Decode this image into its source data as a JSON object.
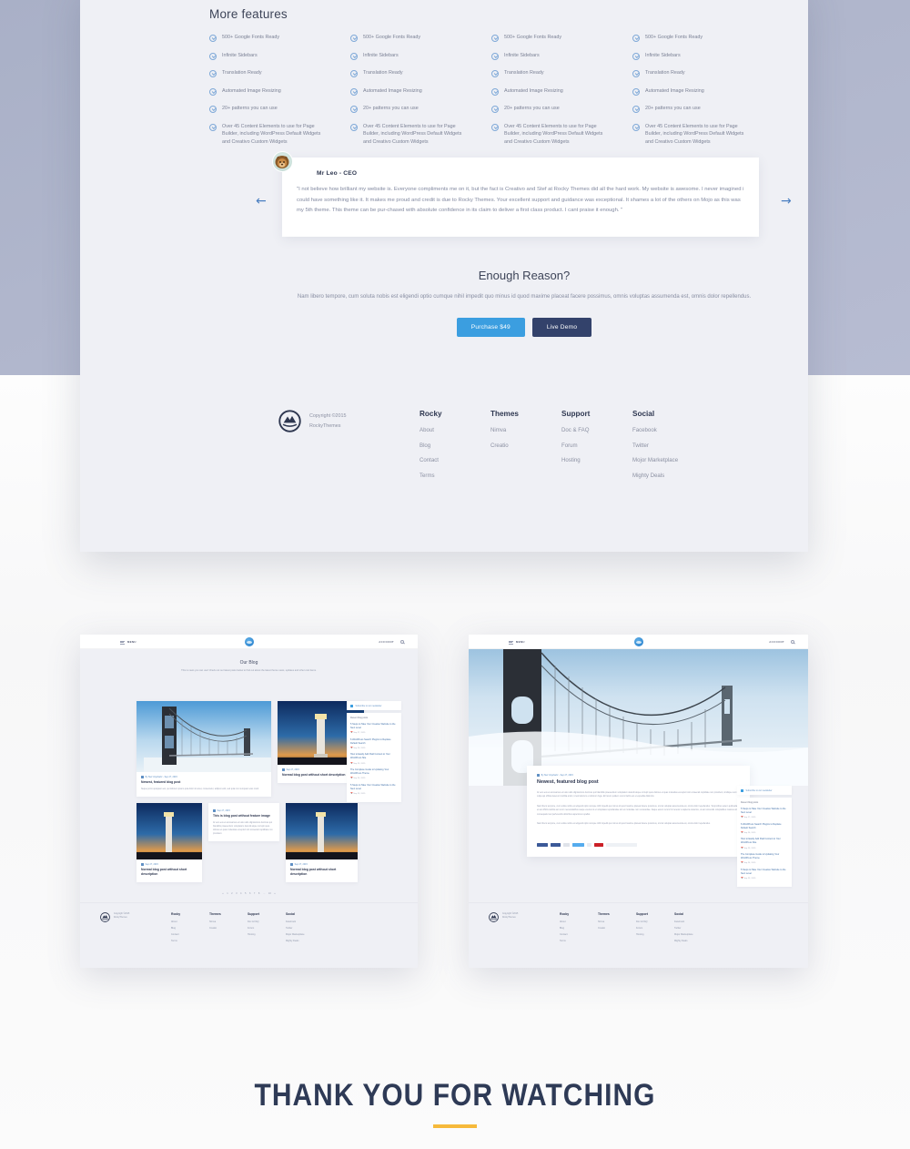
{
  "palette": {
    "page_top": "#a9b0c7",
    "panel_bg": "#eff0f5",
    "accent_blue": "#3b9ee0",
    "navy": "#33426b",
    "amber": "#f6b93b",
    "text_dark": "#2e3750",
    "text_muted": "#8b90a2"
  },
  "features": {
    "title": "More features",
    "columns": [
      [
        "500+ Google Fonts Ready",
        "Infinite Sidebars",
        "Translation Ready",
        "Automated Image Resizing",
        "20+ patterns you can use",
        "Over 45 Content Elements to use for Page Builder, including WordPress Default Widgets and Creativo Custom Widgets"
      ],
      [
        "500+ Google Fonts Ready",
        "Infinite Sidebars",
        "Translation Ready",
        "Automated Image Resizing",
        "20+ patterns you can use",
        "Over 45 Content Elements to use for Page Builder, including WordPress Default Widgets and Creativo Custom Widgets"
      ],
      [
        "500+ Google Fonts Ready",
        "Infinite Sidebars",
        "Translation Ready",
        "Automated Image Resizing",
        "20+ patterns you can use",
        "Over 45 Content Elements to use for Page Builder, including WordPress Default Widgets and Creativo Custom Widgets"
      ],
      [
        "500+ Google Fonts Ready",
        "Infinite Sidebars",
        "Translation Ready",
        "Automated Image Resizing",
        "20+ patterns you can use",
        "Over 45 Content Elements to use for Page Builder, including WordPress Default Widgets and Creativo Custom Widgets"
      ]
    ]
  },
  "testimonial": {
    "author": "Mr Leo - CEO",
    "quote": "\"I not believe how brilliant my website is. Everyone compliments me on it, but the fact is Creativo and Stef at Rocky Themes did all the hard work. My website is awesome. I never imagined i could have something like it. It makes me proud and credit is due to Rocky Themes. Your excellent support and guidance was exceptional. It shames a lot of the others on Mojo as this was my 5th theme. This theme can be pur-chased with absolute confidence in its claim to deliver a first class product. I cant praise it enough. \"",
    "prev_label": "←",
    "next_label": "→"
  },
  "cta": {
    "heading": "Enough Reason?",
    "paragraph": "Nam libero tempore, cum soluta nobis est eligendi optio cumque nihil impedit quo minus id quod maxime placeat facere possimus, omnis voluptas assumenda est, omnis dolor repellendus.",
    "purchase_label": "Purchase $49",
    "demo_label": "Live Demo"
  },
  "footer": {
    "copyright_line1": "Copyright ©2015",
    "copyright_line2": "RockyThemes",
    "columns": [
      {
        "heading": "Rocky",
        "links": [
          "About",
          "Blog",
          "Contact",
          "Terms"
        ]
      },
      {
        "heading": "Themes",
        "links": [
          "Nimva",
          "Creatio"
        ]
      },
      {
        "heading": "Support",
        "links": [
          "Doc & FAQ",
          "Forum",
          "Hosting"
        ]
      },
      {
        "heading": "Social",
        "links": [
          "Facebook",
          "Twitter",
          "Mojor Marketplace",
          "Mighty Deals"
        ]
      }
    ]
  },
  "mockup_browser": {
    "menu_label": "MENU",
    "account_label": "ACCOUNT"
  },
  "mockup_left": {
    "page_title": "Our Blog",
    "page_subtitle": "This is news you can use! Check out our latest posts below to find out about the latest theme news, updates and other cool items.",
    "cards": [
      {
        "meta": "By Stef Urquhartz - Sep 27, 2015",
        "title": "Newest, featured blog post",
        "excerpt": "Neque porro quisquam est, qui dolorem ipsum quia dolor sit amet, consectetur, adipisci velit, sed quia non numquam eius modi."
      },
      {
        "meta": "Sep 27, 2015",
        "title": "Normal blog post without short description",
        "excerpt": ""
      },
      {
        "meta": "Sep 27, 2015",
        "title": "This is blog post without feature image",
        "excerpt": "At vero eos et accusamus et iusto odio dignissimos ducimus qui blanditiis praesentium voluptatum deleniti atque corrupti quos dolores et quas molestias excepturi sint occaecati cupiditate non provident."
      },
      {
        "meta": "Sep 27, 2015",
        "title": "Normal blog post without short description",
        "excerpt": ""
      },
      {
        "meta": "Sep 27, 2015",
        "title": "Normal blog post without short description",
        "excerpt": ""
      }
    ],
    "sidebar": {
      "subscribe_label": "Subscribe to our newsletter",
      "recent_heading": "Recent blog posts",
      "recent": [
        {
          "title": "5 Steps to Take Your Creative Website to the Next Level",
          "date": "Sep 27, 2015"
        },
        {
          "title": "6 WordPress Search Plugins to Replace Default Search",
          "date": "Sep 26, 2015"
        },
        {
          "title": "How to Easily Add Paid Content to Your WordPress Site",
          "date": "Sep 25, 2015"
        },
        {
          "title": "The Complete Guide to Updating Your WordPress Theme",
          "date": "Sep 24, 2015"
        },
        {
          "title": "5 Steps to Take Your Creative Website to the Next Level",
          "date": "Sep 23, 2015"
        }
      ]
    },
    "pagination": [
      "«",
      "1",
      "2",
      "3",
      "4",
      "5",
      "6",
      "7",
      "8",
      "…",
      "10",
      "»"
    ]
  },
  "mockup_right": {
    "article": {
      "meta": "By Stef Urquhartz - Sep 27, 2015",
      "title": "Newest, featured blog post",
      "paragraph1": "At vero eos et accusamus et iusto odio dignissimos ducimus qui blanditiis praesentium voluptatum deleniti atque corrupti quos dolores et quas molestias excepturi sint occaecati cupiditate non provident, similique sunt in culpa qui officia deserunt mollitia animi, id est laborum et dolorum fuga. Et harum quidem rerum facilis est et expedita distinctio.",
      "paragraph2": "Nam libero tempore, cum soluta nobis est eligendi optio cumque nihil impedit quo minus id quod maxime placeat facere possimus, omnis voluptas assumenda est, omnis dolor repellendus. Temporibus autem quibusdam et aut officiis debitis aut rerum necessitatibus saepe eveniet ut et voluptates repudiandae sint et molestiae non recusandae. Itaque earum rerum hic tenetur a sapiente delectus, ut aut reiciendis voluptatibus maiores alias consequatur aut perferendis doloribus asperiores repellat.",
      "paragraph3": "Nam libero tempore, cum soluta nobis est eligendi optio cumque nihil impedit quo minus id quod maxime placeat facere possimus, omnis voluptas assumenda est, omnis dolor repellendus.",
      "share": [
        "Like",
        "Share",
        "Tweet",
        "Pin it"
      ]
    },
    "sidebar": {
      "subscribe_label": "Subscribe to our newsletter",
      "recent_heading": "Recent blog posts",
      "recent": [
        {
          "title": "5 Steps to Take Your Creative Website to the Next Level",
          "date": "Sep 27, 2015"
        },
        {
          "title": "6 WordPress Search Plugins to Replace Default Search",
          "date": "Sep 26, 2015"
        },
        {
          "title": "How to Easily Add Paid Content to Your WordPress Site",
          "date": "Sep 25, 2015"
        },
        {
          "title": "The Complete Guide to Updating Your WordPress Theme",
          "date": "Sep 24, 2015"
        },
        {
          "title": "5 Steps to Take Your Creative Website to the Next Level",
          "date": "Sep 23, 2015"
        }
      ]
    }
  },
  "outro": {
    "heading": "THANK YOU FOR WATCHING"
  }
}
